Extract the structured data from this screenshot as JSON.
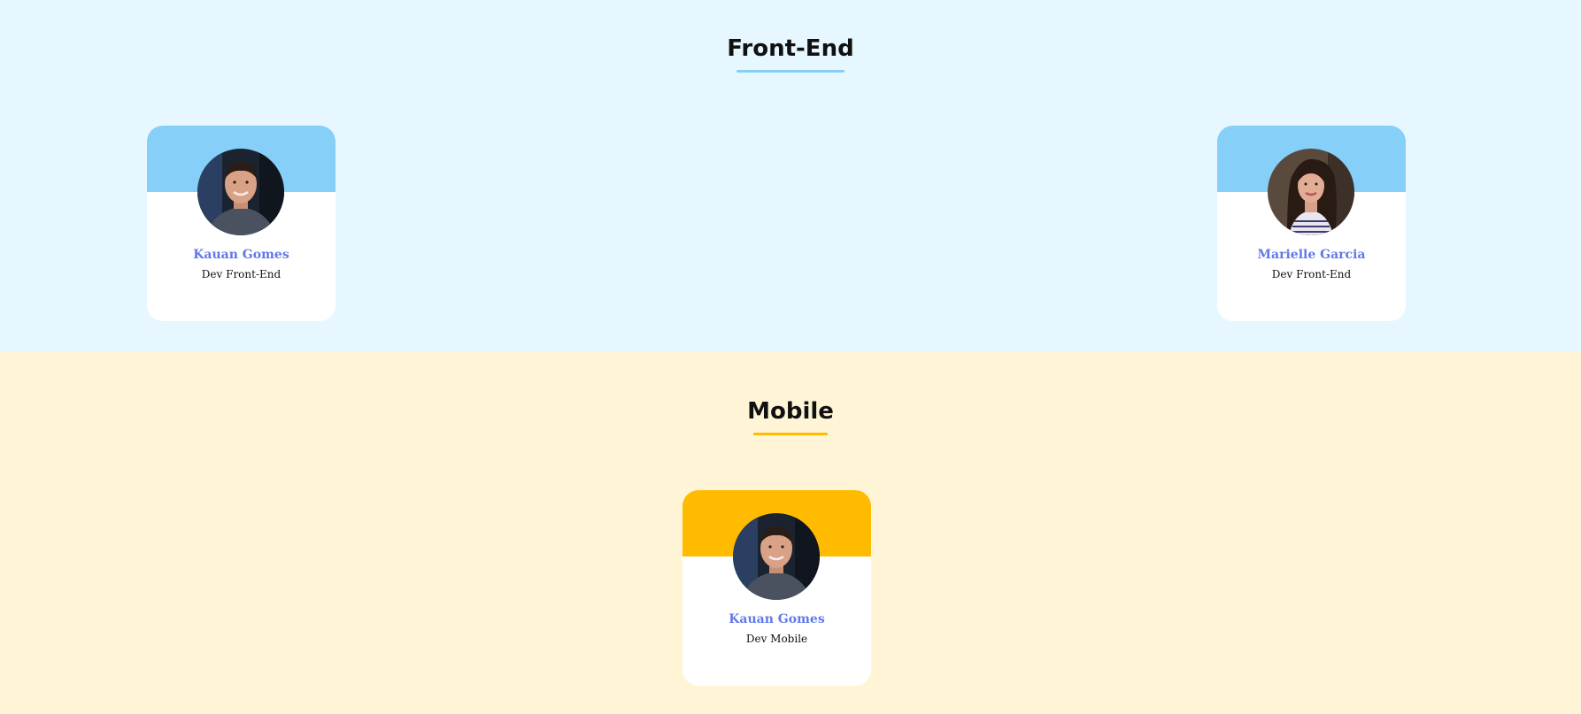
{
  "sections": [
    {
      "title": "Front-End",
      "accent": "#85cff8",
      "background": "#e6f7ff",
      "members": [
        {
          "name": "Kauan Gomes",
          "role": "Dev Front-End",
          "avatar_icon": "male-portrait-icon"
        },
        {
          "name": "Marielle Garcia",
          "role": "Dev Front-End",
          "avatar_icon": "female-portrait-icon"
        }
      ]
    },
    {
      "title": "Mobile",
      "accent": "#ffbb00",
      "background": "#fff5d6",
      "members": [
        {
          "name": "Kauan Gomes",
          "role": "Dev Mobile",
          "avatar_icon": "male-portrait-icon"
        }
      ]
    }
  ],
  "colors": {
    "name_text": "#6278e8",
    "card_background": "#ffffff"
  }
}
